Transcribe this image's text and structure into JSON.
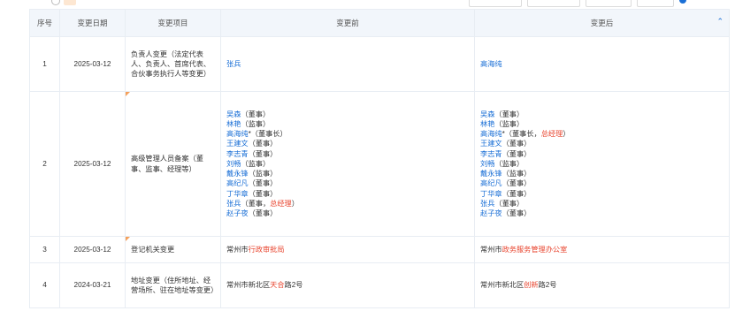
{
  "toolbar": {
    "btn1": "",
    "btn2": "",
    "btn3": "",
    "btn4": "",
    "link": ""
  },
  "headers": [
    "序号",
    "变更日期",
    "变更项目",
    "变更前",
    "变更后"
  ],
  "rows": [
    {
      "no": "1",
      "date": "2025-03-12",
      "item": "负责人变更（法定代表人、负责人、首席代表、合伙事务执行人等变更）",
      "before": [
        {
          "segs": [
            {
              "t": "张兵",
              "c": "blue"
            }
          ]
        }
      ],
      "after": [
        {
          "segs": [
            {
              "t": "高海纯",
              "c": "blue"
            }
          ]
        }
      ]
    },
    {
      "no": "2",
      "date": "2025-03-12",
      "item": "高级管理人员备案（董事、监事、经理等）",
      "before": [
        {
          "segs": [
            {
              "t": "吴森",
              "c": "blue"
            },
            {
              "t": "（董事）",
              "c": "dark"
            }
          ]
        },
        {
          "segs": [
            {
              "t": "林艳",
              "c": "blue"
            },
            {
              "t": "（监事）",
              "c": "dark"
            }
          ]
        },
        {
          "segs": [
            {
              "t": "高海纯",
              "c": "blue"
            },
            {
              "t": "*（董事长）",
              "c": "dark"
            }
          ]
        },
        {
          "segs": [
            {
              "t": "王建文",
              "c": "blue"
            },
            {
              "t": "（董事）",
              "c": "dark"
            }
          ]
        },
        {
          "segs": [
            {
              "t": "李志青",
              "c": "blue"
            },
            {
              "t": "（董事）",
              "c": "dark"
            }
          ]
        },
        {
          "segs": [
            {
              "t": "刘畅",
              "c": "blue"
            },
            {
              "t": "（监事）",
              "c": "dark"
            }
          ]
        },
        {
          "segs": [
            {
              "t": "戴永锋",
              "c": "blue"
            },
            {
              "t": "（监事）",
              "c": "dark"
            }
          ]
        },
        {
          "segs": [
            {
              "t": "高纪凡",
              "c": "blue"
            },
            {
              "t": "（董事）",
              "c": "dark"
            }
          ]
        },
        {
          "segs": [
            {
              "t": "丁华章",
              "c": "blue"
            },
            {
              "t": "（董事）",
              "c": "dark"
            }
          ]
        },
        {
          "segs": [
            {
              "t": "张兵",
              "c": "blue"
            },
            {
              "t": "（董事，",
              "c": "dark"
            },
            {
              "t": "总经理",
              "c": "red"
            },
            {
              "t": "）",
              "c": "dark"
            }
          ]
        },
        {
          "segs": [
            {
              "t": "赵子夜",
              "c": "blue"
            },
            {
              "t": "（董事）",
              "c": "dark"
            }
          ]
        }
      ],
      "after": [
        {
          "segs": [
            {
              "t": "吴森",
              "c": "blue"
            },
            {
              "t": "（董事）",
              "c": "dark"
            }
          ]
        },
        {
          "segs": [
            {
              "t": "林艳",
              "c": "blue"
            },
            {
              "t": "（监事）",
              "c": "dark"
            }
          ]
        },
        {
          "segs": [
            {
              "t": "高海纯",
              "c": "blue"
            },
            {
              "t": "*（董事长，",
              "c": "dark"
            },
            {
              "t": "总经理",
              "c": "red"
            },
            {
              "t": "）",
              "c": "dark"
            }
          ]
        },
        {
          "segs": [
            {
              "t": "王建文",
              "c": "blue"
            },
            {
              "t": "（董事）",
              "c": "dark"
            }
          ]
        },
        {
          "segs": [
            {
              "t": "李志青",
              "c": "blue"
            },
            {
              "t": "（董事）",
              "c": "dark"
            }
          ]
        },
        {
          "segs": [
            {
              "t": "刘畅",
              "c": "blue"
            },
            {
              "t": "（监事）",
              "c": "dark"
            }
          ]
        },
        {
          "segs": [
            {
              "t": "戴永锋",
              "c": "blue"
            },
            {
              "t": "（监事）",
              "c": "dark"
            }
          ]
        },
        {
          "segs": [
            {
              "t": "高纪凡",
              "c": "blue"
            },
            {
              "t": "（董事）",
              "c": "dark"
            }
          ]
        },
        {
          "segs": [
            {
              "t": "丁华章",
              "c": "blue"
            },
            {
              "t": "（董事）",
              "c": "dark"
            }
          ]
        },
        {
          "segs": [
            {
              "t": "张兵",
              "c": "blue"
            },
            {
              "t": "（董事）",
              "c": "dark"
            }
          ]
        },
        {
          "segs": [
            {
              "t": "赵子夜",
              "c": "blue"
            },
            {
              "t": "（董事）",
              "c": "dark"
            }
          ]
        }
      ]
    },
    {
      "no": "3",
      "date": "2025-03-12",
      "item": "登记机关变更",
      "before": [
        {
          "segs": [
            {
              "t": "常州市",
              "c": "dark"
            },
            {
              "t": "行政审批局",
              "c": "red"
            }
          ]
        }
      ],
      "after": [
        {
          "segs": [
            {
              "t": "常州市",
              "c": "dark"
            },
            {
              "t": "政务服务管理办公室",
              "c": "red"
            }
          ]
        }
      ]
    },
    {
      "no": "4",
      "date": "2024-03-21",
      "item": "地址变更（住所地址、经营场所、驻在地址等变更）",
      "before": [
        {
          "segs": [
            {
              "t": "常州市新北区",
              "c": "dark"
            },
            {
              "t": "天合",
              "c": "red"
            },
            {
              "t": "路2号",
              "c": "dark"
            }
          ]
        }
      ],
      "after": [
        {
          "segs": [
            {
              "t": "常州市新北区",
              "c": "dark"
            },
            {
              "t": "创新",
              "c": "red"
            },
            {
              "t": "路2号",
              "c": "dark"
            }
          ]
        }
      ]
    }
  ]
}
